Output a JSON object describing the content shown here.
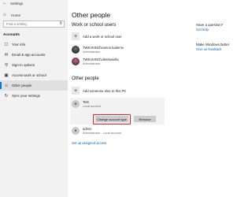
{
  "window": {
    "title": "Settings"
  },
  "sidebar": {
    "back_icon": "back-arrow-icon",
    "home_label": "Home",
    "search_placeholder": "Find a setting",
    "section_title": "Accounts",
    "items": [
      {
        "label": "Your info",
        "icon": "person-card-icon",
        "active": false
      },
      {
        "label": "Email & app accounts",
        "icon": "mail-icon",
        "active": false
      },
      {
        "label": "Sign-in options",
        "icon": "key-icon",
        "active": false
      },
      {
        "label": "Access work or school",
        "icon": "briefcase-icon",
        "active": false
      },
      {
        "label": "Other people",
        "icon": "people-icon",
        "active": true
      },
      {
        "label": "Sync your settings",
        "icon": "sync-icon",
        "active": false
      }
    ]
  },
  "main": {
    "page_title": "Other people",
    "work_section": {
      "heading": "Work or school users",
      "add_label": "Add a work or school user",
      "users": [
        {
          "name": "TWEAKING\\sumon.kaderov",
          "role": "Administrator"
        },
        {
          "name": "TWEAKING\\oltoMusiella",
          "role": "Administrator"
        }
      ]
    },
    "other_section": {
      "heading": "Other people",
      "add_label": "Add someone else to this PC",
      "selected_user": {
        "name": "Test",
        "role": "Local account",
        "change_button": "Change account type",
        "remove_button": "Remove"
      },
      "users": [
        {
          "name": "admin",
          "role": "Administrator - Local account"
        }
      ]
    },
    "assigned_access_link": "Set up assigned access"
  },
  "aside": {
    "question_title": "Have a question?",
    "question_link": "Get help",
    "feedback_title": "Make Windows better",
    "feedback_link": "Give us feedback"
  },
  "colors": {
    "accent": "#0078d7",
    "link": "#0067b8",
    "highlight": "#e2232a",
    "sidebar_bg": "#f2f2f2"
  }
}
